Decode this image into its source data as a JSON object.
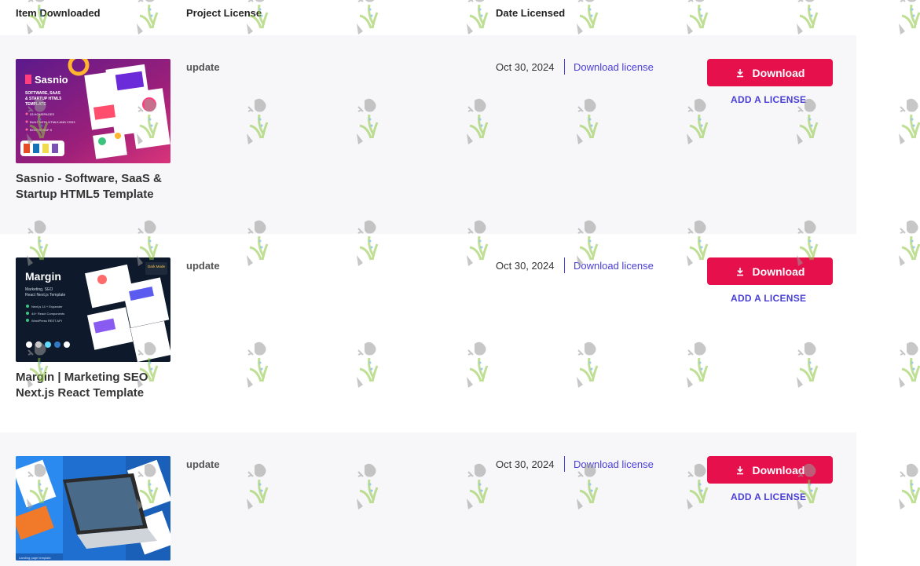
{
  "header": {
    "item": "Item Downloaded",
    "license": "Project License",
    "date": "Date Licensed"
  },
  "rows": [
    {
      "title": "Sasnio - Software, SaaS & Startup HTML5 Template",
      "license": "update",
      "date": "Oct 30, 2024",
      "license_link": "Download license",
      "button": "Download",
      "add": "ADD A LICENSE",
      "thumb": {
        "brand": "Sasnio",
        "tagline": "SOFTWARE, SAAS & STARTUP HTML5 TEMPLATE",
        "bullets": [
          "03 HOMEPAGES",
          "BUILT WITH HTML5 AND CSS3",
          "BOOTSTRAP 5"
        ]
      }
    },
    {
      "title": "Margin | Marketing SEO Next.js React Template",
      "license": "update",
      "date": "Oct 30, 2024",
      "license_link": "Download license",
      "button": "Download",
      "add": "ADD A LICENSE",
      "thumb": {
        "brand": "Margin",
        "tagline": "Marketing, SEO React Next.js Template",
        "badge": "Dark Mode",
        "bullets": [
          "Next.js 14 + Expander",
          "44+ React Components",
          "WordPress REST API"
        ]
      }
    },
    {
      "title": "",
      "license": "update",
      "date": "Oct 30, 2024",
      "license_link": "Download license",
      "button": "Download",
      "add": "ADD A LICENSE",
      "thumb": {
        "caption": "Landing page template"
      }
    }
  ],
  "colors": {
    "accent": "#e6104d",
    "link": "#4a3fd8",
    "alt_row": "#f7f7f9"
  },
  "icons": {
    "download": "download-icon"
  }
}
